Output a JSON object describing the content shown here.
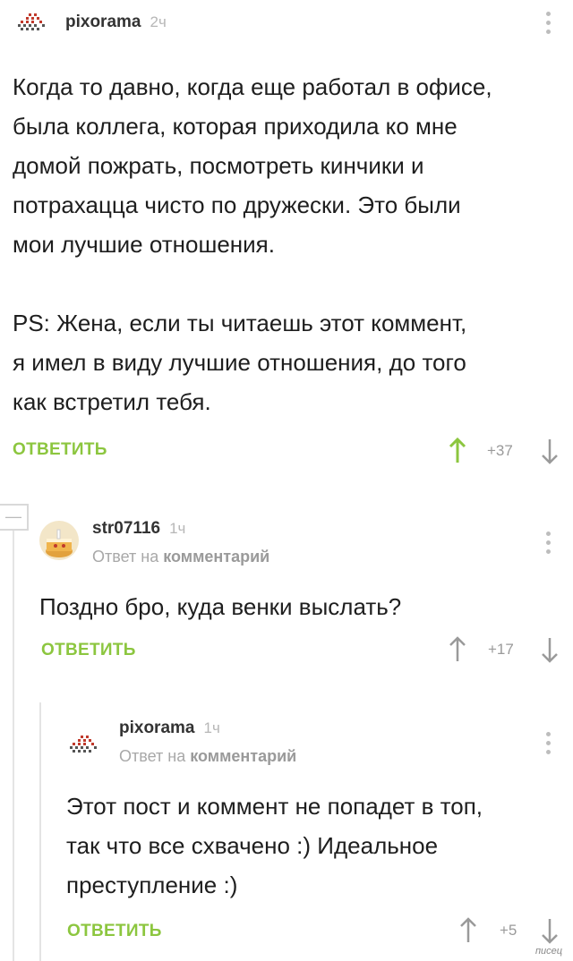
{
  "comments": [
    {
      "username": "pixorama",
      "time": "2ч",
      "lines": [
        "Когда то давно, когда еще работал в офисе,",
        "была коллега, которая приходила ко мне",
        "домой пожрать, посмотреть кинчики и",
        "потрахацца чисто по дружески. Это были",
        "мои лучшие отношения.",
        "",
        "PS: Жена, если ты читаешь этот коммент,",
        "я имел в виду лучшие отношения, до того",
        "как встретил тебя."
      ],
      "reply_label": "ОТВЕТИТЬ",
      "rating": "+37"
    },
    {
      "username": "str07116",
      "time": "1ч",
      "reply_to_prefix": "Ответ на",
      "reply_to_target": "комментарий",
      "lines": [
        "Поздно бро, куда венки выслать?"
      ],
      "reply_label": "ОТВЕТИТЬ",
      "rating": "+17"
    },
    {
      "username": "pixorama",
      "time": "1ч",
      "reply_to_prefix": "Ответ на",
      "reply_to_target": "комментарий",
      "lines": [
        "Этот пост и коммент не попадет в топ,",
        "так что все схвачено :) Идеальное",
        "преступление :)"
      ],
      "reply_label": "ОТВЕТИТЬ",
      "rating": "+5"
    }
  ],
  "collapse_symbol": "—",
  "watermark": "писец",
  "colors": {
    "accent_green": "#8cc63f",
    "upvote_green": "#8cc63f",
    "muted": "#a8a8a8"
  }
}
